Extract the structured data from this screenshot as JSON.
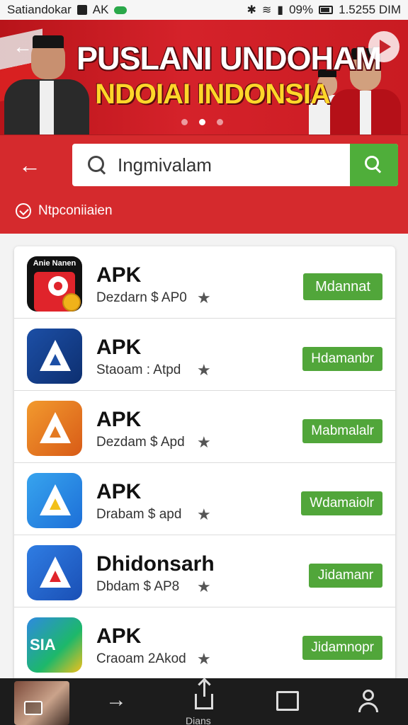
{
  "status_bar": {
    "carrier": "Satiandokar",
    "left_icon_text": "AK",
    "battery": "09%",
    "time": "1.5255 DIM"
  },
  "banner": {
    "title": "PUSLANI UNDOHAM",
    "subtitle": "NDOIAI INDONSIA",
    "slide_count": 3,
    "active_slide": 2
  },
  "search": {
    "value": "Ingmivalam",
    "placeholder": ""
  },
  "recommendation_label": "Ntpconiiaien",
  "apps": [
    {
      "icon_text": "Anie Nanen",
      "name": "APK",
      "subtitle": "Dezdarn $ AP0",
      "button": "Mdannat"
    },
    {
      "icon_text": "",
      "name": "APK",
      "subtitle": "Staoam : Atpd",
      "button": "Hdamanbr"
    },
    {
      "icon_text": "",
      "name": "APK",
      "subtitle": "Dezdam $ Apd",
      "button": "Mabmalalr"
    },
    {
      "icon_text": "",
      "name": "APK",
      "subtitle": "Drabam $ apd",
      "button": "Wdamaiolr"
    },
    {
      "icon_text": "",
      "name": "Dhidonsarh",
      "subtitle": "Dbdam $ AP8",
      "button": "Jidamanr"
    },
    {
      "icon_text": "SIA",
      "name": "APK",
      "subtitle": "Craoam 2Akod",
      "button": "Jidamnopr"
    }
  ],
  "bottom_nav": {
    "share_label": "Dians"
  },
  "colors": {
    "brand_red": "#d52a2d",
    "accent_green": "#51a63a"
  }
}
